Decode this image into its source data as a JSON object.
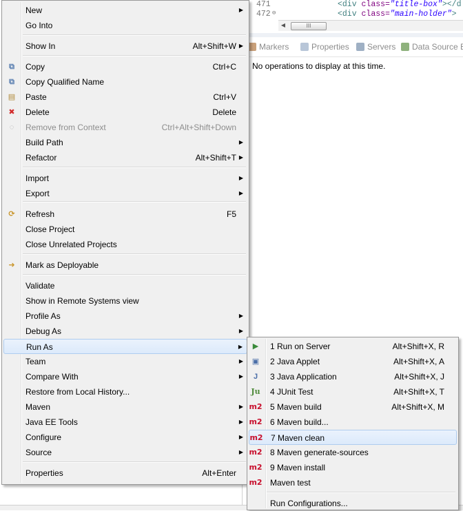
{
  "editor": {
    "lines": [
      {
        "number": "471",
        "code_open": "<div ",
        "attr": "class=",
        "value": "\"title-box\"",
        "code_close": "></d",
        "folded": false
      },
      {
        "number": "472",
        "code_open": "<div ",
        "attr": "class=",
        "value": "\"main-holder\"",
        "code_close": ">",
        "folded": true
      }
    ],
    "scroll_thumb_glyph": "III"
  },
  "views": {
    "tabs": [
      {
        "label": "Markers",
        "icon": "markers-icon"
      },
      {
        "label": "Properties",
        "icon": "properties-icon"
      },
      {
        "label": "Servers",
        "icon": "servers-icon"
      },
      {
        "label": "Data Source E",
        "icon": "data-source-icon"
      }
    ],
    "message": "No operations to display at this time."
  },
  "context_menu": {
    "items": [
      {
        "label": "New",
        "accel": "",
        "submenu": true
      },
      {
        "label": "Go Into",
        "accel": "",
        "submenu": false
      },
      {
        "label": "Show In",
        "accel": "Alt+Shift+W",
        "submenu": true
      },
      {
        "label": "Copy",
        "accel": "Ctrl+C",
        "submenu": false,
        "icon": "copy-icon"
      },
      {
        "label": "Copy Qualified Name",
        "accel": "",
        "submenu": false,
        "icon": "copy-qualified-name-icon"
      },
      {
        "label": "Paste",
        "accel": "Ctrl+V",
        "submenu": false,
        "icon": "paste-icon"
      },
      {
        "label": "Delete",
        "accel": "Delete",
        "submenu": false,
        "icon": "delete-icon"
      },
      {
        "label": "Remove from Context",
        "accel": "Ctrl+Alt+Shift+Down",
        "submenu": false,
        "disabled": true,
        "icon": "remove-context-icon"
      },
      {
        "label": "Build Path",
        "accel": "",
        "submenu": true
      },
      {
        "label": "Refactor",
        "accel": "Alt+Shift+T",
        "submenu": true
      },
      {
        "label": "Import",
        "accel": "",
        "submenu": true
      },
      {
        "label": "Export",
        "accel": "",
        "submenu": true
      },
      {
        "label": "Refresh",
        "accel": "F5",
        "submenu": false,
        "icon": "refresh-icon"
      },
      {
        "label": "Close Project",
        "accel": "",
        "submenu": false
      },
      {
        "label": "Close Unrelated Projects",
        "accel": "",
        "submenu": false
      },
      {
        "label": "Mark as Deployable",
        "accel": "",
        "submenu": false,
        "icon": "deployable-icon"
      },
      {
        "label": "Validate",
        "accel": "",
        "submenu": false
      },
      {
        "label": "Show in Remote Systems view",
        "accel": "",
        "submenu": false
      },
      {
        "label": "Profile As",
        "accel": "",
        "submenu": true
      },
      {
        "label": "Debug As",
        "accel": "",
        "submenu": true
      },
      {
        "label": "Run As",
        "accel": "",
        "submenu": true,
        "highlighted": true
      },
      {
        "label": "Team",
        "accel": "",
        "submenu": true
      },
      {
        "label": "Compare With",
        "accel": "",
        "submenu": true
      },
      {
        "label": "Restore from Local History...",
        "accel": "",
        "submenu": false
      },
      {
        "label": "Maven",
        "accel": "",
        "submenu": true
      },
      {
        "label": "Java EE Tools",
        "accel": "",
        "submenu": true
      },
      {
        "label": "Configure",
        "accel": "",
        "submenu": true
      },
      {
        "label": "Source",
        "accel": "",
        "submenu": true
      },
      {
        "label": "Properties",
        "accel": "Alt+Enter",
        "submenu": false
      }
    ]
  },
  "run_as_menu": {
    "items": [
      {
        "label": "1 Run on Server",
        "accel": "Alt+Shift+X, R",
        "icon": "run-on-server-icon"
      },
      {
        "label": "2 Java Applet",
        "accel": "Alt+Shift+X, A",
        "icon": "java-applet-icon"
      },
      {
        "label": "3 Java Application",
        "accel": "Alt+Shift+X, J",
        "icon": "java-application-icon"
      },
      {
        "label": "4 JUnit Test",
        "accel": "Alt+Shift+X, T",
        "icon": "junit-icon",
        "icon_text": "Ju"
      },
      {
        "label": "5 Maven build",
        "accel": "Alt+Shift+X, M",
        "icon": "maven-icon",
        "icon_text": "m2"
      },
      {
        "label": "6 Maven build...",
        "accel": "",
        "icon": "maven-icon",
        "icon_text": "m2"
      },
      {
        "label": "7 Maven clean",
        "accel": "",
        "icon": "maven-icon",
        "icon_text": "m2",
        "highlighted": true
      },
      {
        "label": "8 Maven generate-sources",
        "accel": "",
        "icon": "maven-icon",
        "icon_text": "m2"
      },
      {
        "label": "9 Maven install",
        "accel": "",
        "icon": "maven-icon",
        "icon_text": "m2"
      },
      {
        "label": "Maven test",
        "accel": "",
        "icon": "maven-icon",
        "icon_text": "m2"
      },
      {
        "label": "Run Configurations...",
        "accel": ""
      }
    ]
  },
  "colors": {
    "menu_bg": "#f0f0f0",
    "highlight_border": "#aeccef",
    "maven_red": "#c8102e"
  }
}
